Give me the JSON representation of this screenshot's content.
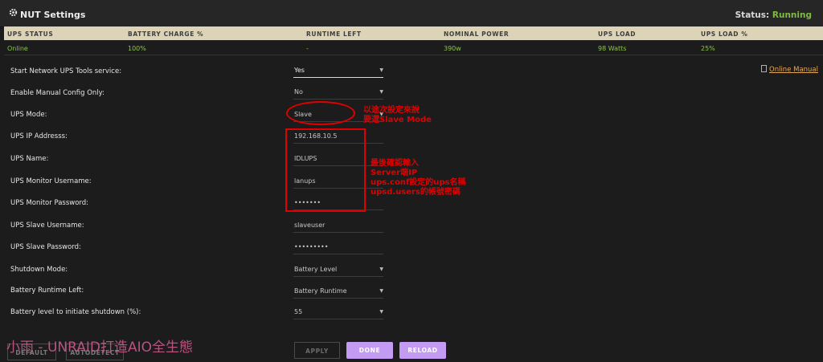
{
  "header": {
    "title": "NUT Settings",
    "status_label": "Status:",
    "status_value": "Running"
  },
  "table": {
    "columns": [
      "UPS STATUS",
      "BATTERY CHARGE %",
      "RUNTIME LEFT",
      "NOMINAL POWER",
      "UPS LOAD",
      "UPS LOAD %"
    ],
    "values": [
      "Online",
      "100%",
      "-",
      "390w",
      "98 Watts",
      "25%"
    ]
  },
  "settings": [
    {
      "label": "Start Network UPS Tools service:",
      "value": "Yes",
      "dropdown": true
    },
    {
      "label": "Enable Manual Config Only:",
      "value": "No",
      "dropdown": true
    },
    {
      "label": "UPS Mode:",
      "value": "Slave",
      "dropdown": true
    },
    {
      "label": "UPS IP Addresss:",
      "value": "192.168.10.5",
      "dropdown": false
    },
    {
      "label": "UPS Name:",
      "value": "IDLUPS",
      "dropdown": false
    },
    {
      "label": "UPS Monitor Username:",
      "value": "lanups",
      "dropdown": false
    },
    {
      "label": "UPS Monitor Password:",
      "value": "•••••••",
      "dropdown": false
    },
    {
      "label": "UPS Slave Username:",
      "value": "slaveuser",
      "dropdown": false
    },
    {
      "label": "UPS Slave Password:",
      "value": "•••••••••",
      "dropdown": false
    },
    {
      "label": "Shutdown Mode:",
      "value": "Battery Level",
      "dropdown": true
    },
    {
      "label": "Battery Runtime Left:",
      "value": "Battery Runtime",
      "dropdown": true
    },
    {
      "label": "Battery level to initiate shutdown (%):",
      "value": "55",
      "dropdown": true
    }
  ],
  "manual_link": "Online Manual",
  "annotations": {
    "mode_note": [
      "以途次設定來說",
      "要選Slave Mode"
    ],
    "server_note": [
      "最後確認輸入",
      "Server端IP",
      "ups.conf設定的ups名稱",
      "upsd.users的帳號密碼"
    ]
  },
  "buttons": {
    "default": "DEFAULT",
    "autodetect": "AUTODETECT",
    "apply": "APPLY",
    "done": "DONE",
    "reload": "RELOAD"
  },
  "watermark": "小雨 - UNRAID打造AIO全生態",
  "colors": {
    "accent_purple": "#c39bf2",
    "status_green": "#8bc34a",
    "annotation_red": "#e00000",
    "link_orange": "#e2a95a"
  }
}
